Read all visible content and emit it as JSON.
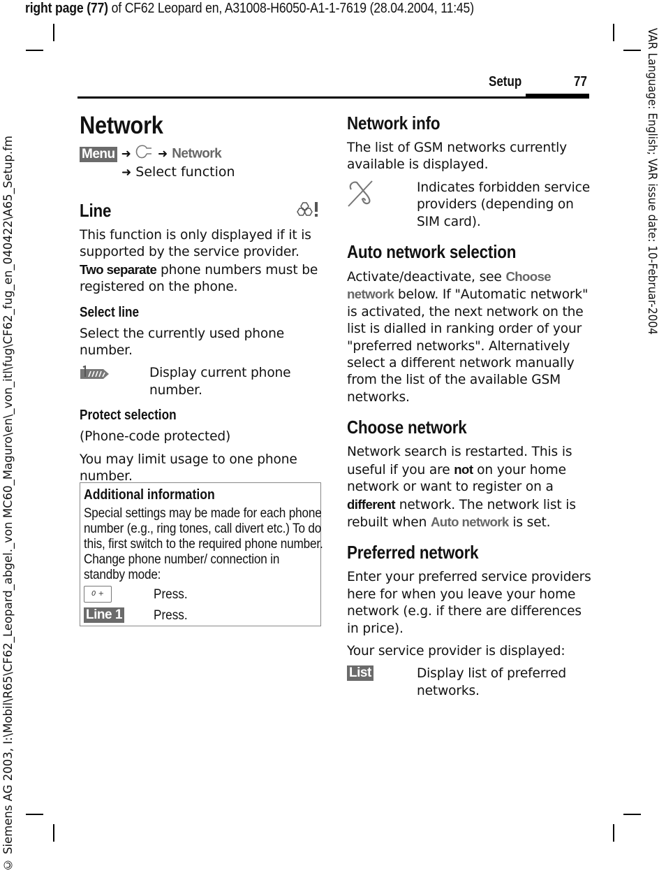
{
  "print_header": {
    "bold_part": "right page (77)",
    "rest": " of CF62 Leopard en, A31008-H6050-A1-1-7619 (28.04.2004, 11:45)"
  },
  "side_text_right": "VAR Language: English; VAR issue date: 10-Februar-2004",
  "side_text_left": "© Siemens AG 2003, I:\\Mobil\\R65\\CF62_Leopard_abgel._von MC60_Maguro\\en\\_von_itl\\fug\\CF62_fug_en_040422\\A65_Setup.fm",
  "running_head": {
    "section": "Setup",
    "page_number": "77"
  },
  "left_column": {
    "title": "Network",
    "nav": {
      "softkey": "Menu",
      "arrow": "➜",
      "icon": "setup-wrench-icon",
      "item": "Network",
      "second_line": "Select function"
    },
    "line_section": {
      "heading": "Line",
      "icon": "sim-provider-dependent-icon",
      "para1": "This function is only displayed if it is supported by the service provider.",
      "para2_bold": "Two separate",
      "para2_rest": " phone numbers must be registered on the phone.",
      "select_line": {
        "heading": "Select line",
        "text": "Select the currently used phone number.",
        "icon": "line-indicator-icon",
        "icon_text": "Display current phone number."
      },
      "protect_selection": {
        "heading": "Protect selection",
        "text1": "(Phone-code protected)",
        "text2": "You may limit usage to one phone number."
      }
    },
    "info_box": {
      "title": "Additional information",
      "body": "Special settings may be made for each phone number (e.g., ring tones, call divert etc.) To do this, first switch to the required phone number. Change phone number/ connection in standby mode:",
      "rows": [
        {
          "key_label": "0 +",
          "key_type": "keypad-zero-key",
          "text": "Press."
        },
        {
          "key_label": "Line 1",
          "key_type": "softkey",
          "text": "Press."
        }
      ]
    }
  },
  "right_column": {
    "network_info": {
      "heading": "Network info",
      "text": "The list of GSM networks currently available is displayed.",
      "icon": "forbidden-network-icon",
      "icon_text": "Indicates forbidden service providers (depending on SIM card)."
    },
    "auto_network": {
      "heading": "Auto network selection",
      "text_a": "Activate/deactivate, see ",
      "ref": "Choose network",
      "text_b": " below. If \"Automatic network\" is activated, the next network on the list is dialled in ranking order of your \"preferred networks\". Alternatively select a different network manually from the list of the available GSM networks."
    },
    "choose_network": {
      "heading": "Choose network",
      "text_a": "Network search is restarted. This is useful if you are ",
      "bold1": "not",
      "text_b": " on your home network or want to register on a ",
      "bold2": "different",
      "text_c": " network. The network list is rebuilt when ",
      "ref": "Auto network",
      "text_d": " is set."
    },
    "preferred_network": {
      "heading": "Preferred network",
      "text1": "Enter your preferred service providers here for when you leave your home network (e.g. if there are differences in price).",
      "text2": "Your service provider is displayed:",
      "softkey": "List",
      "softkey_text": "Display list of preferred networks."
    }
  }
}
